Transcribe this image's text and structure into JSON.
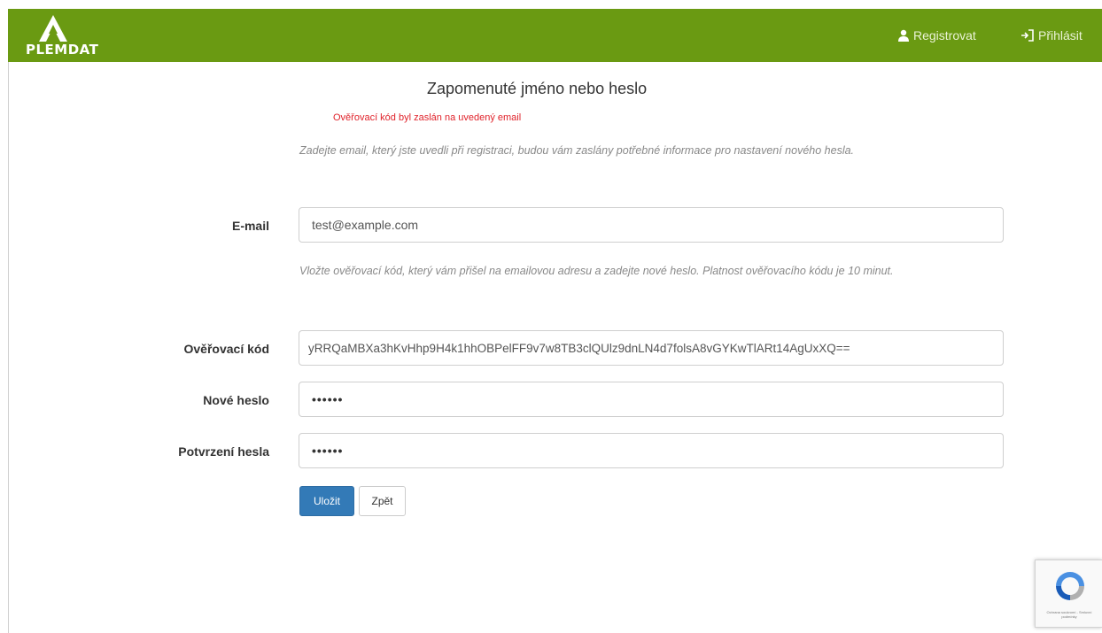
{
  "header": {
    "logo_text": "PLEMDAT",
    "register_label": "Registrovat",
    "login_label": "Přihlásit",
    "background_color": "#6a9a12"
  },
  "page": {
    "title": "Zapomenuté jméno nebo heslo",
    "alert": "Ověřovací kód byl zaslán na uvedený email",
    "help_email": "Zadejte email, který jste uvedli při registraci, budou vám zaslány potřebné informace pro nastavení nového hesla.",
    "help_code": "Vložte ověřovací kód, který vám přišel na emailovou adresu a zadejte nové heslo. Platnost ověřovacího kódu je 10 minut."
  },
  "form": {
    "email_label": "E-mail",
    "email_value": "test@example.com",
    "code_label": "Ověřovací kód",
    "code_value": "yRRQaMBXa3hKvHhp9H4k1hhOBPelFF9v7w8TB3clQUlz9dnLN4d7folsA8vGYKwTlARt14AgUxXQ==",
    "new_password_label": "Nové heslo",
    "new_password_value": "••••••",
    "confirm_password_label": "Potvrzení hesla",
    "confirm_password_value": "••••••",
    "save_label": "Uložit",
    "back_label": "Zpět"
  },
  "recaptcha": {
    "text": "Ochrana soukromí - Smluvní podmínky"
  }
}
